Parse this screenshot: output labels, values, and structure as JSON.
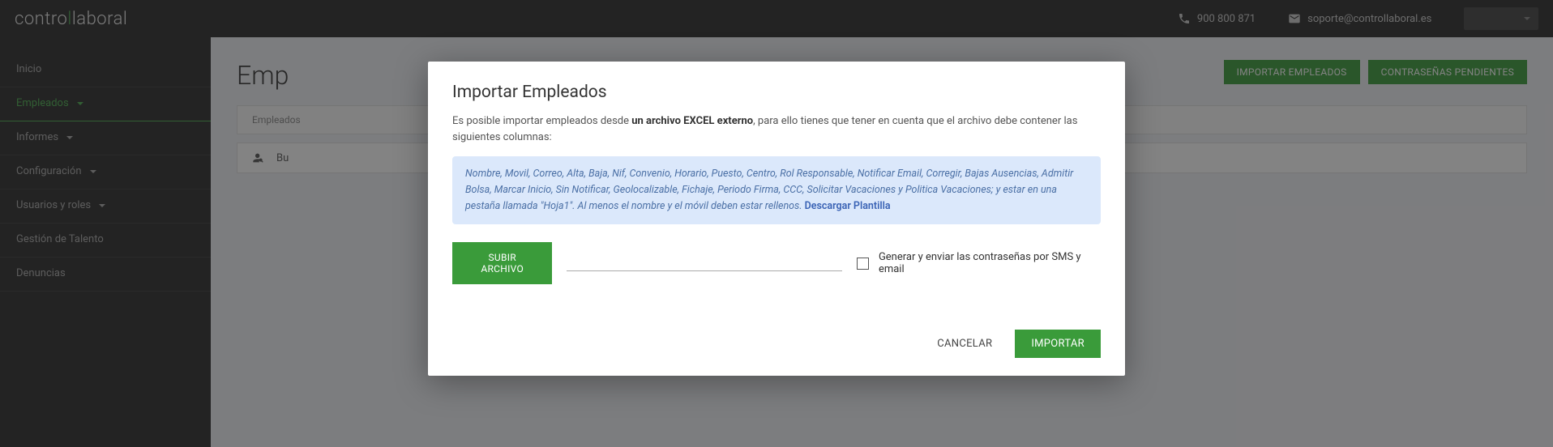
{
  "header": {
    "logo_left": "contro",
    "logo_accent": "l",
    "logo_right": "laboral",
    "phone": "900 800 871",
    "email": "soporte@controllaboral.es"
  },
  "sidebar": {
    "items": [
      {
        "label": "Inicio",
        "hasCaret": false,
        "active": false
      },
      {
        "label": "Empleados",
        "hasCaret": true,
        "active": true
      },
      {
        "label": "Informes",
        "hasCaret": true,
        "active": false
      },
      {
        "label": "Configuración",
        "hasCaret": true,
        "active": false
      },
      {
        "label": "Usuarios y roles",
        "hasCaret": true,
        "active": false
      },
      {
        "label": "Gestión de Talento",
        "hasCaret": false,
        "active": false
      },
      {
        "label": "Denuncias",
        "hasCaret": false,
        "active": false
      }
    ]
  },
  "page": {
    "title_partial": "Emp",
    "actions": {
      "import": "IMPORTAR EMPLEADOS",
      "passwords": "CONTRASEÑAS PENDIENTES"
    },
    "tab_label": "Empleados",
    "search_partial": "Bu"
  },
  "modal": {
    "title": "Importar Empleados",
    "desc_pre": "Es posible importar empleados desde ",
    "desc_bold": "un archivo EXCEL externo",
    "desc_post": ", para ello tienes que tener en cuenta que el archivo debe contener las siguientes columnas:",
    "info_text": "Nombre, Movil, Correo, Alta, Baja, Nif, Convenio, Horario, Puesto, Centro, Rol Responsable, Notificar Email, Corregir, Bajas Ausencias, Admitir Bolsa, Marcar Inicio, Sin Notificar, Geolocalizable, Fichaje, Periodo Firma, CCC, Solicitar Vacaciones y Politica Vacaciones; y estar en una pestaña llamada \"Hoja1\". Al menos el nombre y el móvil deben estar rellenos. ",
    "info_link": "Descargar Plantilla",
    "upload_btn": "SUBIR ARCHIVO",
    "checkbox_label": "Generar y enviar las contraseñas por SMS y email",
    "cancel": "CANCELAR",
    "import": "IMPORTAR"
  }
}
